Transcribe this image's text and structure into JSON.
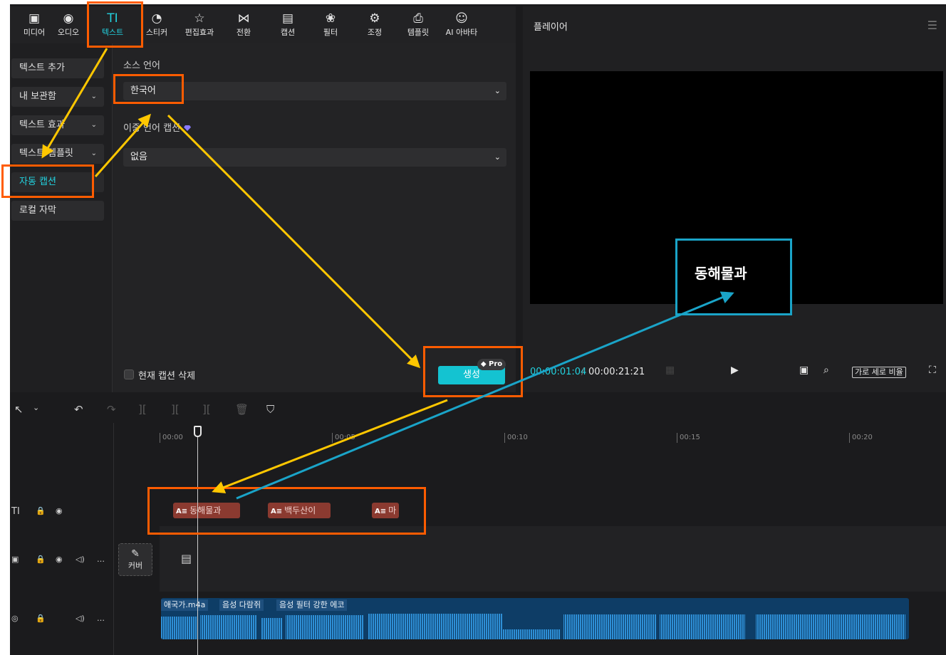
{
  "toolbar": {
    "tabs": [
      {
        "label": "미디어",
        "icon": "media-icon"
      },
      {
        "label": "오디오",
        "icon": "audio-icon"
      },
      {
        "label": "텍스트",
        "icon": "text-icon",
        "active": true
      },
      {
        "label": "스티커",
        "icon": "sticker-icon"
      },
      {
        "label": "편집효과",
        "icon": "effects-icon"
      },
      {
        "label": "전환",
        "icon": "transition-icon"
      },
      {
        "label": "캡션",
        "icon": "caption-icon"
      },
      {
        "label": "필터",
        "icon": "filter-icon"
      },
      {
        "label": "조정",
        "icon": "adjust-icon"
      },
      {
        "label": "템플릿",
        "icon": "template-icon"
      },
      {
        "label": "AI 아바타",
        "icon": "avatar-icon"
      }
    ]
  },
  "leftnav": {
    "items": [
      {
        "label": "텍스트 추가"
      },
      {
        "label": "내 보관함"
      },
      {
        "label": "텍스트 효과"
      },
      {
        "label": "텍스트 템플릿"
      },
      {
        "label": "자동 캡션",
        "active": true
      },
      {
        "label": "로컬 자막"
      }
    ]
  },
  "settings": {
    "source_lang_label": "소스 언어",
    "source_lang_value": "한국어",
    "bilingual_label": "이중 언어 캡션",
    "bilingual_value": "없음",
    "delete_label": "현재 캡션 삭제",
    "generate_label": "생성",
    "pro_label": "Pro"
  },
  "player": {
    "title": "플레이어",
    "time_current": "00:00:01:04",
    "time_sep": "/",
    "time_total": "00:00:21:21",
    "ratio_label": "가로 세로 비율"
  },
  "timeline": {
    "ruler": [
      "00:00",
      "00:05",
      "00:10",
      "00:15",
      "00:20"
    ],
    "cover_label": "커버",
    "text_clips": [
      {
        "label": "동해물과"
      },
      {
        "label": "백두산이"
      },
      {
        "label": "마"
      }
    ],
    "audio_tags": [
      "애국가.m4a",
      "음성 다람쥐",
      "음성 필터 강한 에코"
    ]
  },
  "annotation": {
    "caption_text": "동해물과"
  },
  "colors": {
    "accent": "#22d3e0",
    "annotation_orange": "#ff5c00",
    "annotation_yellow": "#ffc700",
    "annotation_blue": "#1aa4c8"
  }
}
